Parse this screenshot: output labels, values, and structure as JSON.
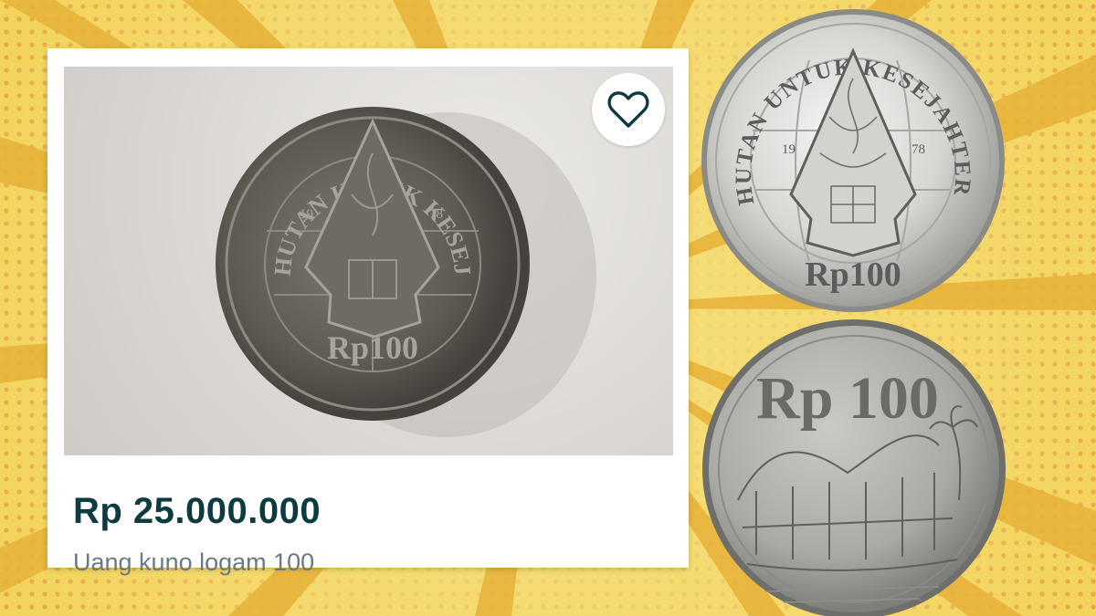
{
  "listing": {
    "price": "Rp 25.000.000",
    "title": "Uang kuno logam 100",
    "favorite_icon": "heart-outline-icon"
  },
  "coin_front": {
    "legend": "HUTAN UNTUK KESEJAHTERAAN",
    "year_left": "19",
    "year_right": "78",
    "denomination": "Rp100"
  },
  "coin_back": {
    "denomination": "Rp 100"
  },
  "colors": {
    "background": "#f2d35a",
    "ray": "#e7b93a",
    "dot": "#e08a3c",
    "price_text": "#0d3b40",
    "title_text": "#6b7a80",
    "icon_stroke": "#0d3b40"
  }
}
